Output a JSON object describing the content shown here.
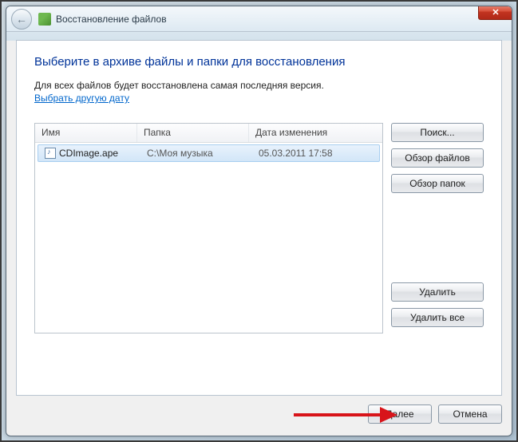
{
  "window": {
    "title": "Восстановление файлов"
  },
  "page": {
    "heading": "Выберите в архиве файлы и папки для восстановления",
    "subtext": "Для всех файлов будет восстановлена самая последняя версия.",
    "link_other_date": "Выбрать другую дату"
  },
  "columns": {
    "name": "Имя",
    "folder": "Папка",
    "date": "Дата изменения"
  },
  "files": [
    {
      "name": "CDImage.ape",
      "folder": "C:\\Моя музыка",
      "date": "05.03.2011 17:58"
    }
  ],
  "buttons": {
    "search": "Поиск...",
    "browse_files": "Обзор файлов",
    "browse_folders": "Обзор папок",
    "delete": "Удалить",
    "delete_all": "Удалить все",
    "next": "Далее",
    "cancel": "Отмена"
  }
}
